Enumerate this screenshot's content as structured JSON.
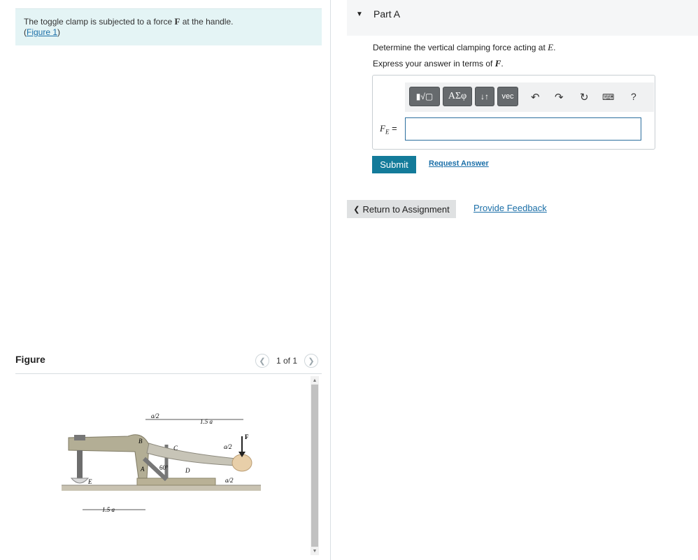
{
  "problem": {
    "text_before": "The toggle clamp is subjected to a force ",
    "force_symbol": "F",
    "text_after": " at the handle.",
    "figure_link_open": "(",
    "figure_link": "Figure 1",
    "figure_link_close": ")"
  },
  "figure_panel": {
    "title": "Figure",
    "pager_text": "1 of 1",
    "prev_icon": "chevron-left-icon",
    "next_icon": "chevron-right-icon",
    "labels": {
      "a_half_top": "a/2",
      "one_five_a_top": "1.5 a",
      "B": "B",
      "C": "C",
      "A": "A",
      "D": "D",
      "angle": "60°",
      "E": "E",
      "F": "F",
      "a_half_right_1": "a/2",
      "a_half_right_2": "a/2",
      "one_five_a_bottom": "1.5 a"
    }
  },
  "part": {
    "title": "Part A",
    "question_text": "Determine the vertical clamping force acting at ",
    "question_point": "E",
    "question_end": ".",
    "instruction_text": "Express your answer in terms of ",
    "instruction_var": "F",
    "instruction_end": "."
  },
  "toolbar": {
    "templates_label": "▮√▢",
    "greek_label": "ΑΣφ",
    "arrows_label": "↓↑",
    "vec_label": "vec",
    "undo_icon": "undo-icon",
    "redo_icon": "redo-icon",
    "reset_icon": "reset-icon",
    "keyboard_icon": "keyboard-icon",
    "help_label": "?"
  },
  "answer": {
    "label_var": "F",
    "label_sub": "E",
    "label_eq": " =",
    "value": ""
  },
  "actions": {
    "submit_label": "Submit",
    "request_label": "Request Answer",
    "return_label": "Return to Assignment",
    "feedback_label": "Provide Feedback"
  },
  "colors": {
    "problem_bg": "#e4f4f5",
    "submit_bg": "#137b9a",
    "link": "#1b6fa8",
    "toolbar_button": "#666a6d"
  }
}
